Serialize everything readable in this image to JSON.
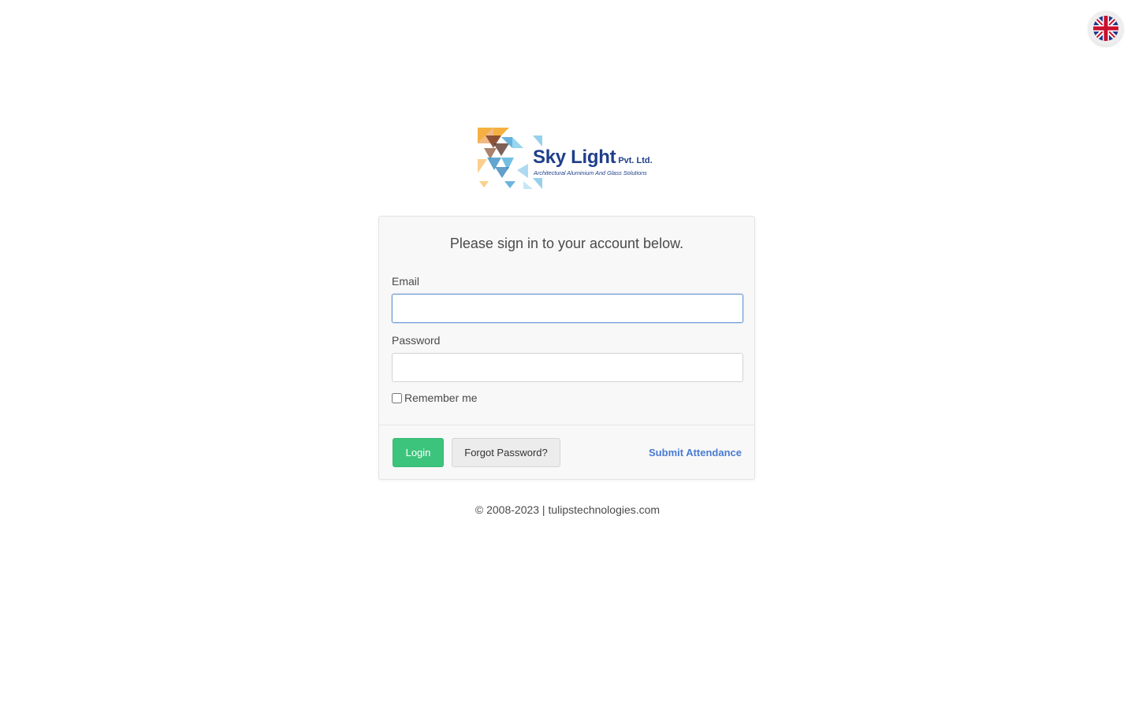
{
  "language": {
    "current": "English (UK)",
    "icon": "uk-flag-icon"
  },
  "logo": {
    "name": "Sky Light",
    "suffix": "Pvt. Ltd.",
    "tagline": "Architectural Aluminium And Glass Solutions",
    "colors": {
      "primary": "#1f3f8a",
      "tile_blue": "#5ab4dc",
      "tile_orange": "#f5a623"
    }
  },
  "login": {
    "heading": "Please sign in to your account below.",
    "email_label": "Email",
    "email_value": "",
    "password_label": "Password",
    "password_value": "",
    "remember_label": "Remember me",
    "remember_checked": false,
    "login_button": "Login",
    "forgot_button": "Forgot Password?",
    "attendance_link": "Submit Attendance"
  },
  "footer": {
    "copyright": "© 2008-2023 | tulipstechnologies.com"
  },
  "colors": {
    "accent_green": "#3cc47c",
    "link_blue": "#4a7bd3",
    "focus_blue": "#6e9bd6"
  }
}
